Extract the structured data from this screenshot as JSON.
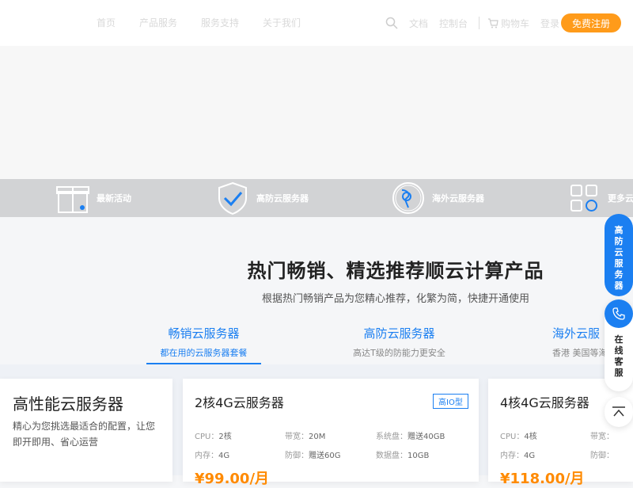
{
  "header": {
    "logo_icon": "cloud-logo-icon",
    "nav": [
      "首页",
      "产品服务",
      "服务支持",
      "关于我们"
    ],
    "links": {
      "docs": "文档",
      "console": "控制台",
      "cart": "购物车",
      "login": "登录"
    },
    "register": "免费注册",
    "colors": {
      "accent": "#ff9b1a",
      "primary": "#1b7ff1"
    }
  },
  "quicknav": [
    {
      "icon": "gift-icon",
      "label": "最新活动"
    },
    {
      "icon": "shield-check-icon",
      "label": "高防云服务器"
    },
    {
      "icon": "globe-icon",
      "label": "海外云服务器"
    },
    {
      "icon": "grid-icon",
      "label": "更多云"
    }
  ],
  "section": {
    "title": "热门畅销、精选推荐顺云计算产品",
    "subtitle": "根据热门畅销产品为您精心推荐，化繁为简，快捷开通使用"
  },
  "tabs": [
    {
      "title": "畅销云服务器",
      "desc": "都在用的云服务器套餐"
    },
    {
      "title": "高防云服务器",
      "desc": "高达T级的防能力更安全"
    },
    {
      "title": "海外云服",
      "desc": "香港 美国等海"
    }
  ],
  "intro": {
    "title": "高性能云服务器",
    "desc": "精心为您挑选最适合的配置，让您即开即用、省心运营"
  },
  "cards": [
    {
      "title": "2核4G云服务器",
      "badge": "高IO型",
      "specs": {
        "cpu_label": "CPU：",
        "cpu": "2核",
        "bw_label": "带宽：",
        "bw": "20M",
        "sys_label": "系统盘：",
        "sys": "赠送40GB",
        "mem_label": "内存：",
        "mem": "4G",
        "def_label": "防御：",
        "def": "赠送60G",
        "data_label": "数据盘：",
        "data": "10GB"
      },
      "price": "¥99.00/月"
    },
    {
      "title": "4核4G云服务器",
      "specs": {
        "cpu_label": "CPU：",
        "cpu": "4核",
        "bw_label": "带宽：",
        "mem_label": "内存：",
        "mem": "4G",
        "def_label": "防御："
      },
      "price": "¥118.00/月"
    }
  ],
  "side": {
    "float1": "高防云服务器",
    "float2": "在线客服",
    "phone_icon": "phone-icon",
    "top_icon": "back-to-top-icon"
  }
}
